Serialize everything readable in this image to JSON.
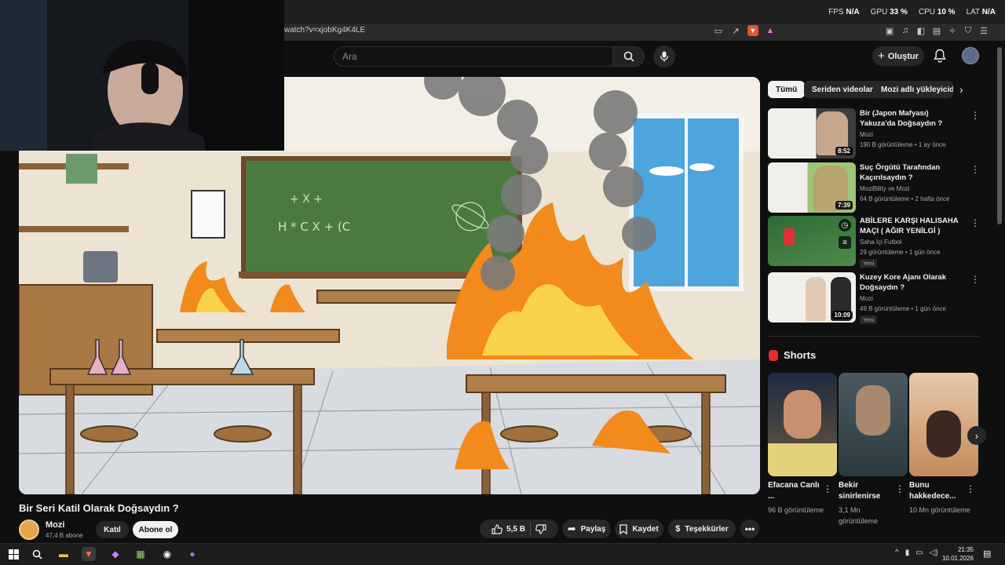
{
  "perf": {
    "fps_label": "FPS",
    "fps": "N/A",
    "gpu_label": "GPU",
    "gpu": "33 %",
    "cpu_label": "CPU",
    "cpu": "10 %",
    "lat_label": "LAT",
    "lat": "N/A"
  },
  "browser": {
    "url": "watch?v=xjobKg4K4LE"
  },
  "header": {
    "search_placeholder": "Ara",
    "create_label": "Oluştur"
  },
  "video": {
    "title": "Bir Seri Katil Olarak Doğsaydın ?",
    "chalk1": "H * C X + (C",
    "chalk2": "+ X +"
  },
  "channel": {
    "name": "Mozi",
    "subs": "47,4 B abone",
    "join_label": "Katıl",
    "subscribe_label": "Abone ol"
  },
  "actions": {
    "likes": "5,5 B",
    "share": "Paylaş",
    "save": "Kaydet",
    "thanks": "Teşekkürler"
  },
  "chips": [
    "Tümü",
    "Seriden videolar",
    "Mozi adlı yükleyicide"
  ],
  "recommendations": [
    {
      "title": "Bir (Japon Mafyası) Yakuza'da Doğsaydın ?",
      "channel": "Mozi",
      "meta": "190 B görüntüleme • 1 ay önce",
      "duration": "8:52",
      "new": ""
    },
    {
      "title": "Suç Örgütü Tarafından Kaçırılsaydın ?",
      "channel": "MoziBility ve Mozi",
      "meta": "64 B görüntüleme • 2 hafta önce",
      "duration": "7:39",
      "new": ""
    },
    {
      "title": "ABİLERE KARŞI HALISAHA MAÇI ( AĞIR YENİLGİ )",
      "channel": "Saha İçi Futbol",
      "meta": "29 görüntüleme • 1 gün önce",
      "duration": "",
      "new": "Yeni"
    },
    {
      "title": "Kuzey Kore Ajanı Olarak Doğsaydın ?",
      "channel": "Mozi",
      "meta": "49 B görüntüleme • 1 gün önce",
      "duration": "10:09",
      "new": "Yeni"
    }
  ],
  "shorts": {
    "heading": "Shorts",
    "items": [
      {
        "title": "Efacana Canlı ...",
        "views": "96 B görüntüleme"
      },
      {
        "title": "Bekir sinirlenirse",
        "views": "3,1 Mn görüntüleme"
      },
      {
        "title": "Bunu hakkedece...",
        "views": "10 Mn görüntüleme"
      }
    ]
  },
  "taskbar": {
    "time": "21:35",
    "date": "10.01.2026"
  }
}
